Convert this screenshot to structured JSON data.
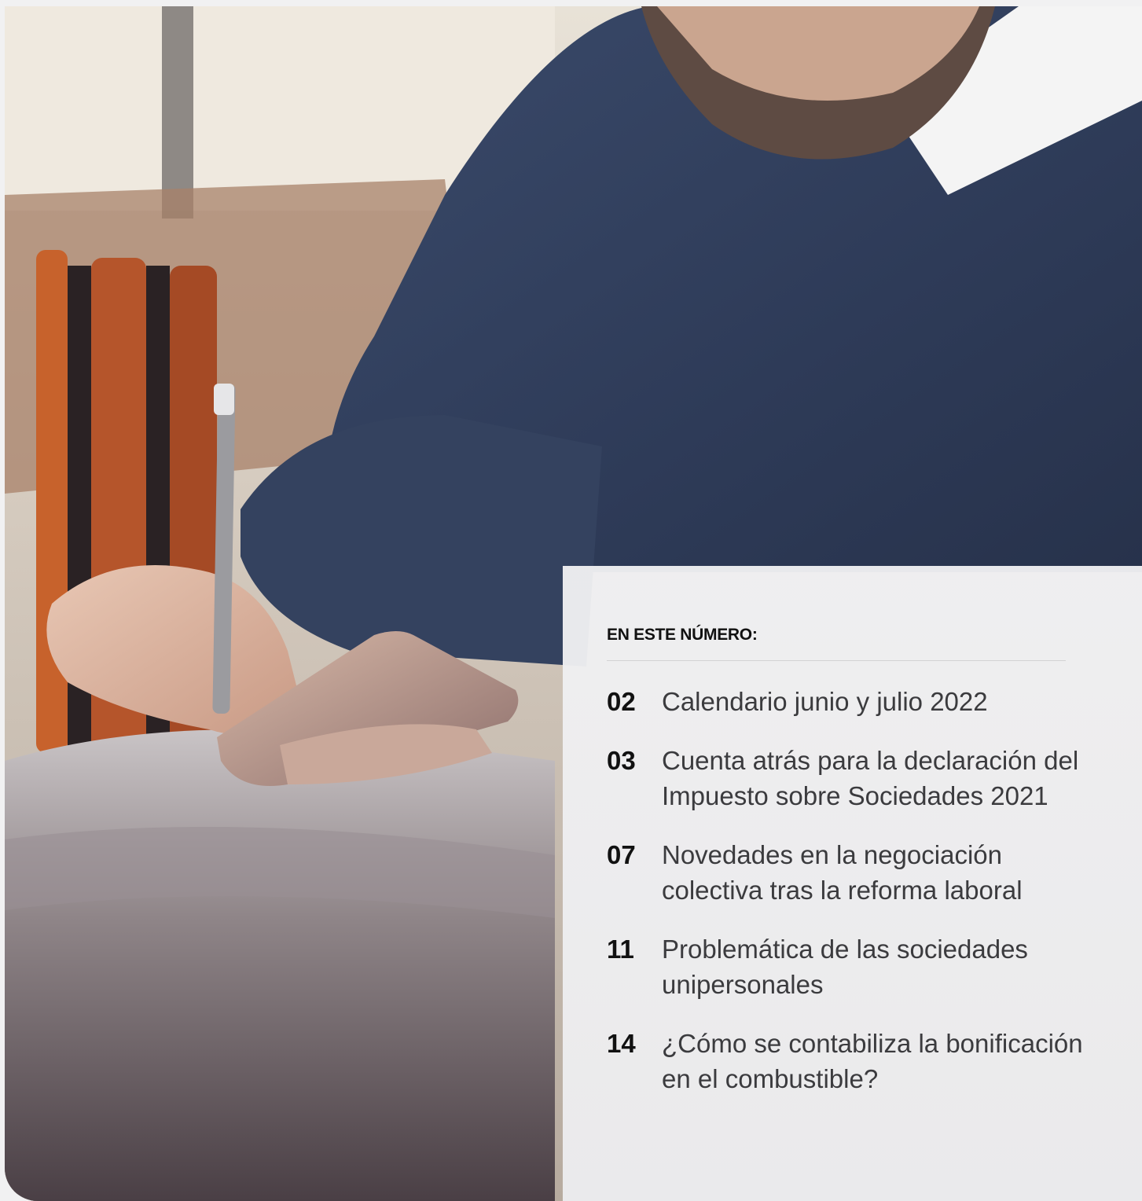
{
  "photo": {
    "alt_subject": "man-writing-photo"
  },
  "toc": {
    "heading": "EN ESTE NÚMERO:",
    "items": [
      {
        "number": "02",
        "title": "Calendario junio y julio 2022"
      },
      {
        "number": "03",
        "title": "Cuenta atrás para la declaración del Impuesto sobre Sociedades 2021"
      },
      {
        "number": "07",
        "title": "Novedades en la negociación colectiva tras la reforma laboral"
      },
      {
        "number": "11",
        "title": "Problemática de las sociedades unipersonales"
      },
      {
        "number": "14",
        "title": "¿Cómo se contabiliza la bonificación en el combustible?"
      }
    ]
  },
  "colors": {
    "panel_bg": "#efeff1",
    "number_color": "#111111",
    "title_color": "#3b3b3e",
    "sweater": "#2f3c58"
  }
}
